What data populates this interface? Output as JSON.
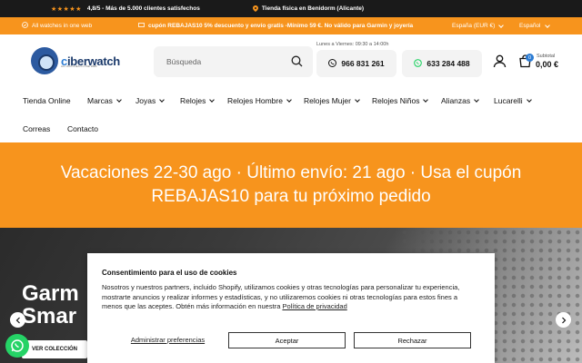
{
  "topbar": {
    "stars": "★★★★★",
    "rating": "4,8/5 - Más de 5.000 clientes satisfechos",
    "store": "Tienda física en Benidorm (Alicante)"
  },
  "promobar": {
    "left_text": "All watches in one web",
    "promo_text": "cupón REBAJAS10 5% descuento y envío gratis -Mínimo 59 €. No válido para Garmin y joyería",
    "region": "España (EUR €)",
    "language": "Español"
  },
  "header": {
    "logo_text_a": "c",
    "logo_text_b": "iberwatch",
    "logo_tagline": "ALL WATCHES IN ONE WEB",
    "search_placeholder": "Búsqueda",
    "hours": "Lunes a Viernes: 09:30 a 14:00h",
    "phone": "966 831 261",
    "whatsapp_phone": "633 284 488",
    "cart_count": "0",
    "subtotal_label": "Subtotal",
    "subtotal_value": "0,00 €"
  },
  "nav": {
    "items": [
      {
        "label": "Tienda Online"
      },
      {
        "label": "Marcas"
      },
      {
        "label": "Joyas"
      },
      {
        "label": "Relojes"
      },
      {
        "label": "Relojes Hombre"
      },
      {
        "label": "Relojes Mujer"
      },
      {
        "label": "Relojes Niños"
      },
      {
        "label": "Alianzas"
      },
      {
        "label": "Lucarelli"
      },
      {
        "label": "Correas"
      },
      {
        "label": "Contacto"
      }
    ]
  },
  "banner": {
    "text": "Vacaciones 22-30 ago · Último envío: 21 ago · Usa el cupón REBAJAS10 para tu próximo pedido"
  },
  "hero": {
    "title_line1": "Garm",
    "title_line2": "Smar",
    "cta": "VER COLECCIÓN"
  },
  "consent": {
    "title": "Consentimiento para el uso de cookies",
    "text": "Nosotros y nuestros partners, incluido Shopify, utilizamos cookies y otras tecnologías para personalizar tu experiencia, mostrarte anuncios y realizar informes y estadísticas, y no utilizaremos cookies ni otras tecnologías para estos fines a menos que las aceptes. Obtén más información en nuestra",
    "privacy_link": "Política de privacidad",
    "manage": "Administrar preferencias",
    "accept": "Aceptar",
    "reject": "Rechazar"
  },
  "colors": {
    "orange": "#f7941d",
    "dark": "#1a1a1a",
    "whatsapp": "#25d366",
    "brand_blue": "#2b7bd3"
  }
}
